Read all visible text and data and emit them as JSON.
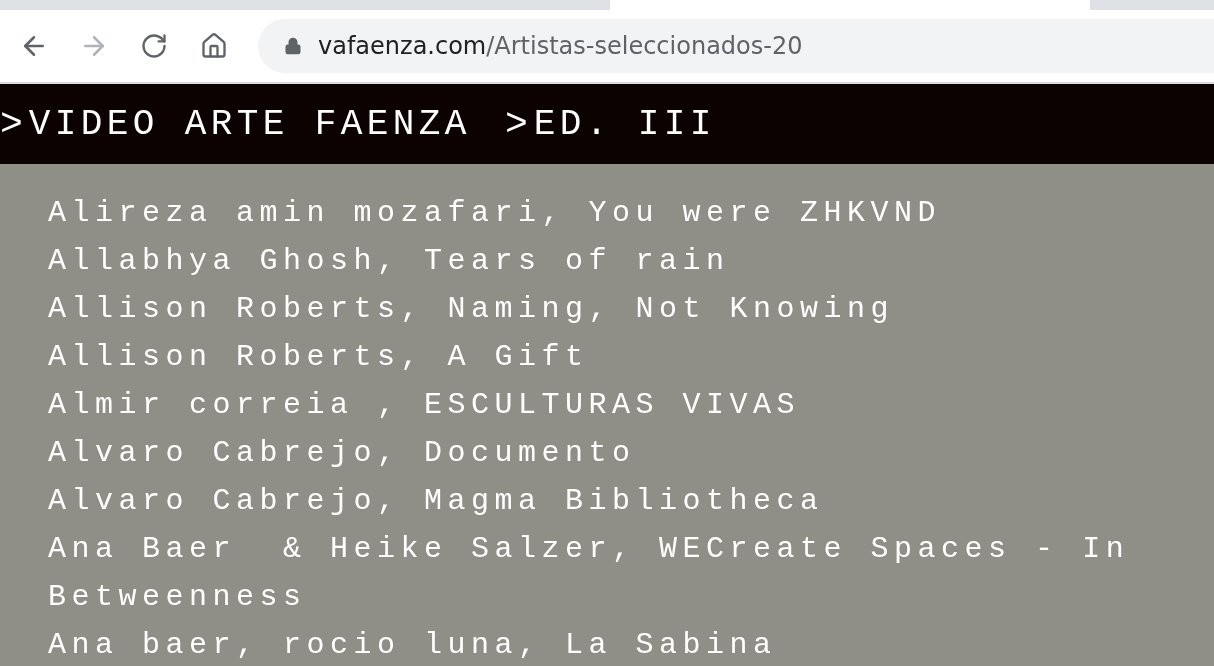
{
  "browser": {
    "url_host": "vafaenza.com",
    "url_path": "/Artistas-seleccionados-20",
    "forward_disabled": true
  },
  "header": {
    "crumbs": [
      {
        "glyph": ">",
        "label": "VIDEO ARTE FAENZA"
      },
      {
        "glyph": ">",
        "label": "ED. III"
      }
    ]
  },
  "entries": [
    "Alireza amin mozafari, You were ZHKVND",
    "Allabhya Ghosh, Tears of rain",
    "Allison Roberts, Naming, Not Knowing",
    "Allison Roberts, A Gift",
    "Almir correia , ESCULTURAS VIVAS",
    "Alvaro Cabrejo, Documento",
    "Alvaro Cabrejo, Magma Bibliotheca",
    "Ana Baer  & Heike Salzer, WECreate Spaces - In Betweenness",
    "Ana baer, rocio luna, La Sabina"
  ]
}
